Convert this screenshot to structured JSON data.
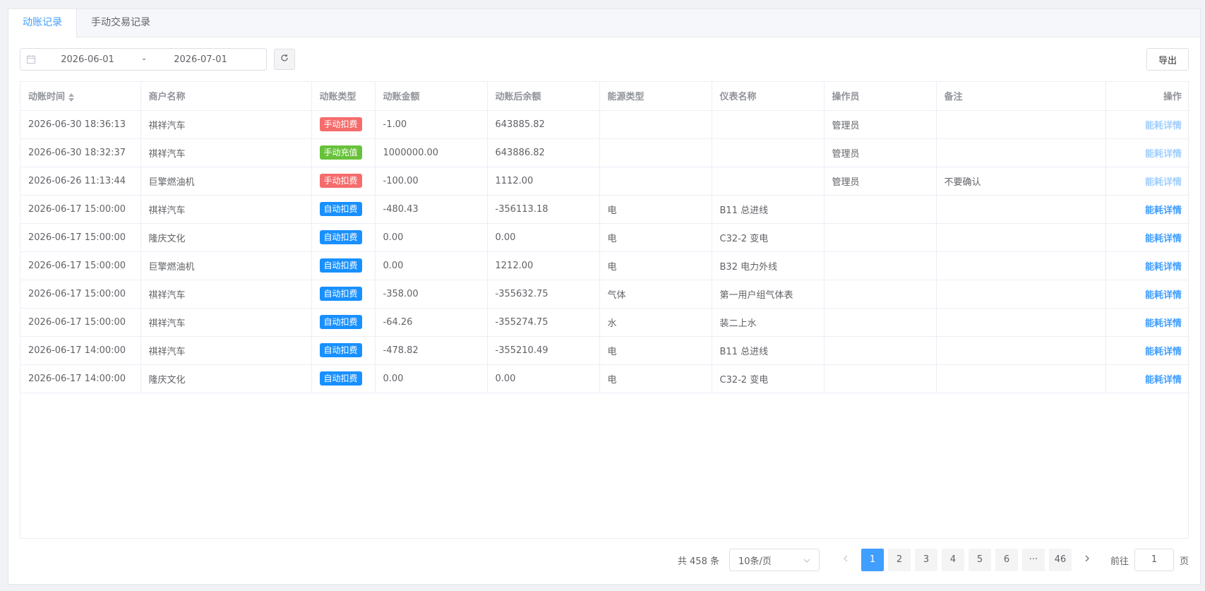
{
  "tabs": [
    {
      "label": "动账记录",
      "active": true
    },
    {
      "label": "手动交易记录",
      "active": false
    }
  ],
  "date_range": {
    "start": "2026-06-01",
    "separator": "-",
    "end": "2026-07-01"
  },
  "toolbar": {
    "export_label": "导出"
  },
  "table": {
    "columns": [
      "动账时间",
      "商户名称",
      "动账类型",
      "动账金额",
      "动账后余额",
      "能源类型",
      "仪表名称",
      "操作员",
      "备注",
      "操作"
    ],
    "rows": [
      {
        "time": "2026-06-30 18:36:13",
        "merchant": "祺祥汽车",
        "type": "手动扣费",
        "type_color": "#f56c6c",
        "amount": "-1.00",
        "balance": "643885.82",
        "energy": "",
        "meter": "",
        "operator": "管理员",
        "note": "",
        "action": "能耗详情",
        "action_disabled": true
      },
      {
        "time": "2026-06-30 18:32:37",
        "merchant": "祺祥汽车",
        "type": "手动充值",
        "type_color": "#67c23a",
        "amount": "1000000.00",
        "balance": "643886.82",
        "energy": "",
        "meter": "",
        "operator": "管理员",
        "note": "",
        "action": "能耗详情",
        "action_disabled": true
      },
      {
        "time": "2026-06-26 11:13:44",
        "merchant": "巨擎燃油机",
        "type": "手动扣费",
        "type_color": "#f56c6c",
        "amount": "-100.00",
        "balance": "1112.00",
        "energy": "",
        "meter": "",
        "operator": "管理员",
        "note": "不要确认",
        "action": "能耗详情",
        "action_disabled": true
      },
      {
        "time": "2026-06-17 15:00:00",
        "merchant": "祺祥汽车",
        "type": "自动扣费",
        "type_color": "#1890ff",
        "amount": "-480.43",
        "balance": "-356113.18",
        "energy": "电",
        "meter": "B11 总进线",
        "operator": "",
        "note": "",
        "action": "能耗详情",
        "action_disabled": false
      },
      {
        "time": "2026-06-17 15:00:00",
        "merchant": "隆庆文化",
        "type": "自动扣费",
        "type_color": "#1890ff",
        "amount": "0.00",
        "balance": "0.00",
        "energy": "电",
        "meter": "C32-2 变电",
        "operator": "",
        "note": "",
        "action": "能耗详情",
        "action_disabled": false
      },
      {
        "time": "2026-06-17 15:00:00",
        "merchant": "巨擎燃油机",
        "type": "自动扣费",
        "type_color": "#1890ff",
        "amount": "0.00",
        "balance": "1212.00",
        "energy": "电",
        "meter": "B32 电力外线",
        "operator": "",
        "note": "",
        "action": "能耗详情",
        "action_disabled": false
      },
      {
        "time": "2026-06-17 15:00:00",
        "merchant": "祺祥汽车",
        "type": "自动扣费",
        "type_color": "#1890ff",
        "amount": "-358.00",
        "balance": "-355632.75",
        "energy": "气体",
        "meter": "第一用户组气体表",
        "operator": "",
        "note": "",
        "action": "能耗详情",
        "action_disabled": false
      },
      {
        "time": "2026-06-17 15:00:00",
        "merchant": "祺祥汽车",
        "type": "自动扣费",
        "type_color": "#1890ff",
        "amount": "-64.26",
        "balance": "-355274.75",
        "energy": "水",
        "meter": "装二上水",
        "operator": "",
        "note": "",
        "action": "能耗详情",
        "action_disabled": false
      },
      {
        "time": "2026-06-17 14:00:00",
        "merchant": "祺祥汽车",
        "type": "自动扣费",
        "type_color": "#1890ff",
        "amount": "-478.82",
        "balance": "-355210.49",
        "energy": "电",
        "meter": "B11 总进线",
        "operator": "",
        "note": "",
        "action": "能耗详情",
        "action_disabled": false
      },
      {
        "time": "2026-06-17 14:00:00",
        "merchant": "隆庆文化",
        "type": "自动扣费",
        "type_color": "#1890ff",
        "amount": "0.00",
        "balance": "0.00",
        "energy": "电",
        "meter": "C32-2 变电",
        "operator": "",
        "note": "",
        "action": "能耗详情",
        "action_disabled": false
      }
    ]
  },
  "pagination": {
    "total_text": "共 458 条",
    "page_size": "10条/页",
    "pages": [
      "1",
      "2",
      "3",
      "4",
      "5",
      "6",
      "···",
      "46"
    ],
    "current": "1",
    "goto_prefix": "前往",
    "goto_value": "1",
    "goto_suffix": "页"
  },
  "icons": {
    "calendar": "calendar-icon",
    "refresh": "refresh-icon",
    "sort": "sort-icon",
    "chevron": "chevron-down-icon",
    "prev": "chevron-left-icon",
    "next": "chevron-right-icon"
  },
  "colors": {
    "primary": "#409eff",
    "danger": "#f56c6c",
    "success": "#67c23a",
    "info_blue": "#1890ff"
  }
}
